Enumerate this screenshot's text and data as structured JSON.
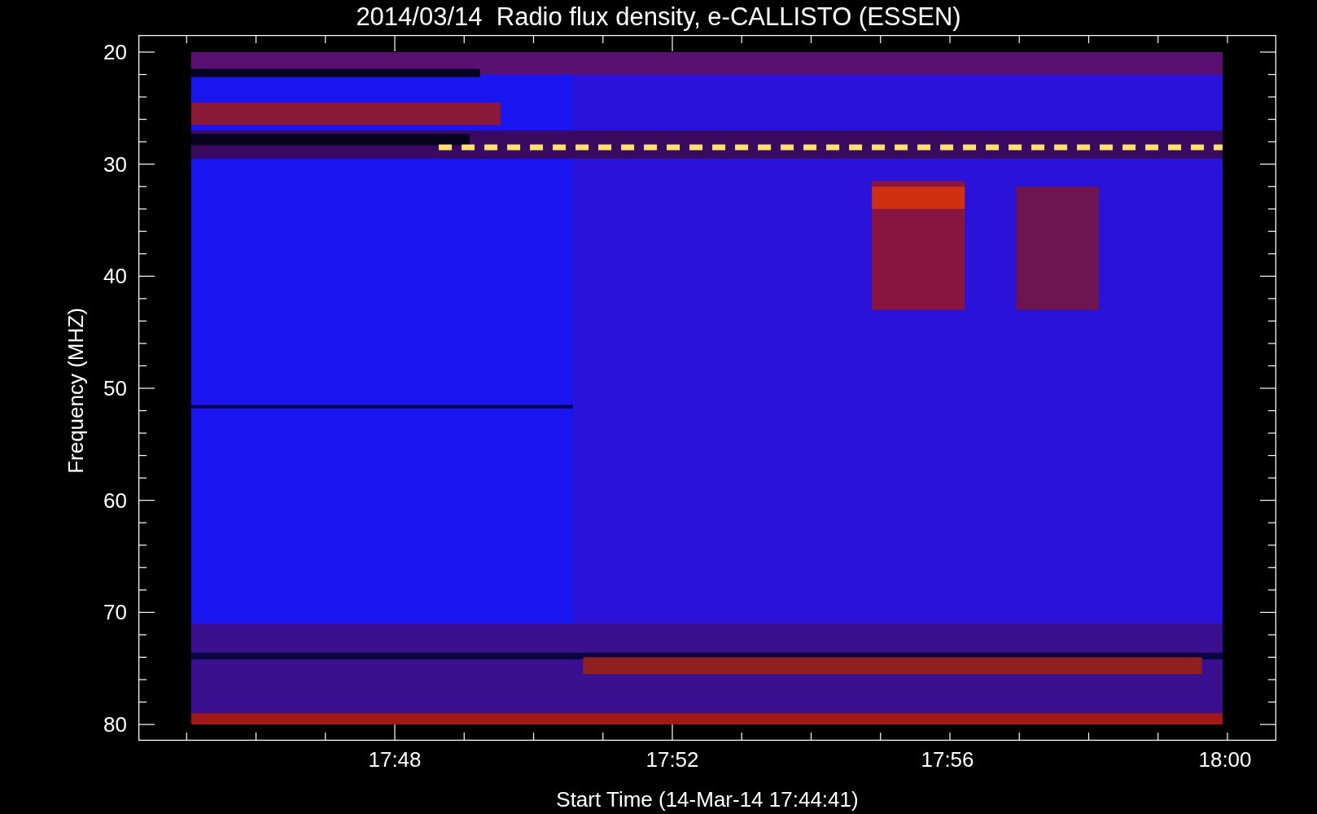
{
  "title": "2014/03/14  Radio flux density, e-CALLISTO (ESSEN)",
  "y_axis": {
    "label": "Frequency (MHZ)",
    "ticks": [
      "20",
      "30",
      "40",
      "50",
      "60",
      "70",
      "80"
    ]
  },
  "x_axis": {
    "label": "Start Time (14-Mar-14 17:44:41)",
    "ticks": [
      "17:48",
      "17:52",
      "17:56",
      "18:00"
    ]
  }
}
